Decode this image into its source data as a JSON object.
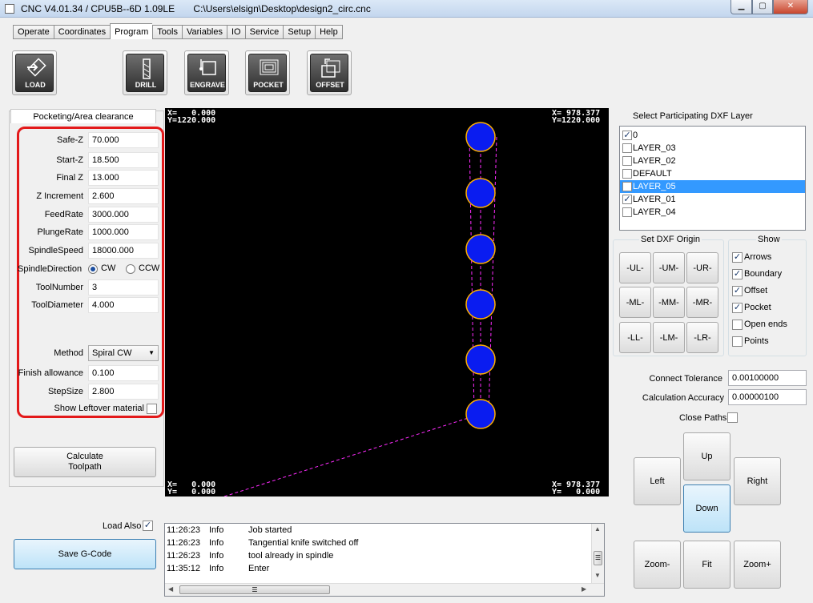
{
  "window": {
    "title": "CNC V4.01.34 / CPU5B--6D 1.09LE       C:\\Users\\elsign\\Desktop\\design2_circ.cnc",
    "min": "▁",
    "max": "▢",
    "close": "✕"
  },
  "tabs": [
    "Operate",
    "Coordinates",
    "Program",
    "Tools",
    "Variables",
    "IO",
    "Service",
    "Setup",
    "Help"
  ],
  "active_tab": "Program",
  "toolbar": {
    "load": "LOAD",
    "drill": "DRILL",
    "engrave": "ENGRAVE",
    "pocket": "POCKET",
    "offset": "OFFSET"
  },
  "pocket": {
    "panel_title": "Pocketing/Area clearance",
    "fields": [
      {
        "label": "Safe-Z",
        "value": "70.000"
      },
      {
        "label": "Start-Z",
        "value": "18.500"
      },
      {
        "label": "Final Z",
        "value": "13.000"
      },
      {
        "label": "Z Increment",
        "value": "2.600"
      },
      {
        "label": "FeedRate",
        "value": "3000.000"
      },
      {
        "label": "PlungeRate",
        "value": "1000.000"
      },
      {
        "label": "SpindleSpeed",
        "value": "18000.000"
      }
    ],
    "spindle_direction_label": "SpindleDirection",
    "cw_label": "CW",
    "ccw_label": "CCW",
    "tool_number_label": "ToolNumber",
    "tool_number": "3",
    "tool_diameter_label": "ToolDiameter",
    "tool_diameter": "4.000",
    "method_label": "Method",
    "method_value": "Spiral CW",
    "finish_label": "Finish allowance",
    "finish_value": "0.100",
    "stepsize_label": "StepSize",
    "stepsize_value": "2.800",
    "leftover_label": "Show Leftover material",
    "calculate_label": "Calculate\nToolpath",
    "load_also_label": "Load Also",
    "save_gcode_label": "Save G-Code"
  },
  "canvas": {
    "top_left": "X=   0.000\nY=1220.000",
    "top_right": "X= 978.377\nY=1220.000",
    "bottom_left": "X=   0.000\nY=   0.000",
    "bottom_right": "X= 978.377\nY=   0.000"
  },
  "layers": {
    "title": "Select Participating DXF Layer",
    "items": [
      {
        "name": "0",
        "checked": true,
        "selected": false
      },
      {
        "name": "LAYER_03",
        "checked": false,
        "selected": false
      },
      {
        "name": "LAYER_02",
        "checked": false,
        "selected": false
      },
      {
        "name": "DEFAULT",
        "checked": false,
        "selected": false
      },
      {
        "name": "LAYER_05",
        "checked": false,
        "selected": true
      },
      {
        "name": "LAYER_01",
        "checked": true,
        "selected": false
      },
      {
        "name": "LAYER_04",
        "checked": false,
        "selected": false
      }
    ]
  },
  "origin": {
    "title": "Set DXF Origin",
    "buttons": [
      "-UL-",
      "-UM-",
      "-UR-",
      "-ML-",
      "-MM-",
      "-MR-",
      "-LL-",
      "-LM-",
      "-LR-"
    ]
  },
  "show": {
    "title": "Show",
    "items": [
      {
        "label": "Arrows",
        "checked": true
      },
      {
        "label": "Boundary",
        "checked": true
      },
      {
        "label": "Offset",
        "checked": true
      },
      {
        "label": "Pocket",
        "checked": true
      },
      {
        "label": "Open ends",
        "checked": false
      },
      {
        "label": "Points",
        "checked": false
      }
    ]
  },
  "tolerance": {
    "connect_label": "Connect Tolerance",
    "connect_value": "0.00100000",
    "accuracy_label": "Calculation Accuracy",
    "accuracy_value": "0.00000100",
    "close_paths_label": "Close Paths"
  },
  "nav": {
    "up": "Up",
    "left": "Left",
    "right": "Right",
    "down": "Down",
    "zoom_out": "Zoom-",
    "fit": "Fit",
    "zoom_in": "Zoom+"
  },
  "log": [
    {
      "time": "11:26:23",
      "level": "Info",
      "msg": "Job started"
    },
    {
      "time": "11:26:23",
      "level": "Info",
      "msg": "Tangential knife switched off"
    },
    {
      "time": "11:26:23",
      "level": "Info",
      "msg": "tool already in spindle"
    },
    {
      "time": "11:35:12",
      "level": "Info",
      "msg": "Enter"
    }
  ],
  "check_mark": "✓",
  "arrows": {
    "up": "▲",
    "down": "▼",
    "left": "◀",
    "right": "▶",
    "grip": "☰"
  }
}
